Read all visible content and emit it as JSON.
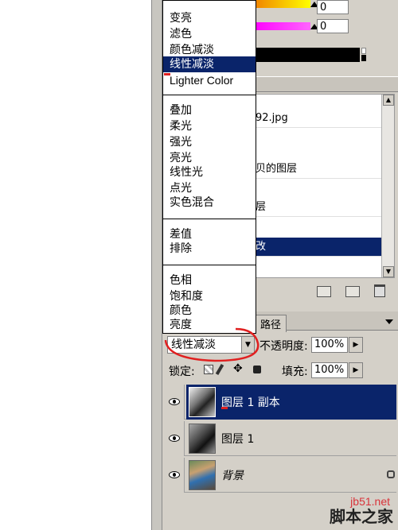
{
  "colors": {
    "panel_bg": "#d4d0c8",
    "selection": "#0a246a",
    "annotation": "#e02020"
  },
  "color_panel": {
    "value_1": "0",
    "value_2": "0"
  },
  "blend_menu": {
    "group_darken": [
      "变亮",
      "滤色",
      "颜色减淡",
      "线性减淡",
      "Lighter Color"
    ],
    "group_overlay": [
      "叠加",
      "柔光",
      "强光",
      "亮光",
      "线性光",
      "点光",
      "实色混合"
    ],
    "group_difference": [
      "差值",
      "排除"
    ],
    "group_color": [
      "色相",
      "饱和度",
      "颜色",
      "亮度"
    ],
    "highlighted": "线性减淡"
  },
  "history": {
    "items": [
      "92.jpg",
      "贝的图层",
      "层",
      "改"
    ],
    "selected_index": 3
  },
  "layers_panel": {
    "tab_label": "路径",
    "blend_mode": "线性减淡",
    "opacity_label": "不透明度:",
    "opacity_value": "100%",
    "lock_label": "锁定:",
    "fill_label": "填充:",
    "fill_value": "100%",
    "layers": [
      {
        "name": "图层 1 副本",
        "selected": true,
        "visible": true,
        "thumb_icon": "bw-photo-thumb"
      },
      {
        "name": "图层 1",
        "selected": false,
        "visible": true,
        "thumb_icon": "bw-photo-thumb"
      },
      {
        "name": "背景",
        "selected": false,
        "visible": true,
        "thumb_icon": "color-photo-thumb",
        "locked": true
      }
    ]
  },
  "watermark": {
    "site": "jb51.net",
    "brand": "脚本之家"
  }
}
